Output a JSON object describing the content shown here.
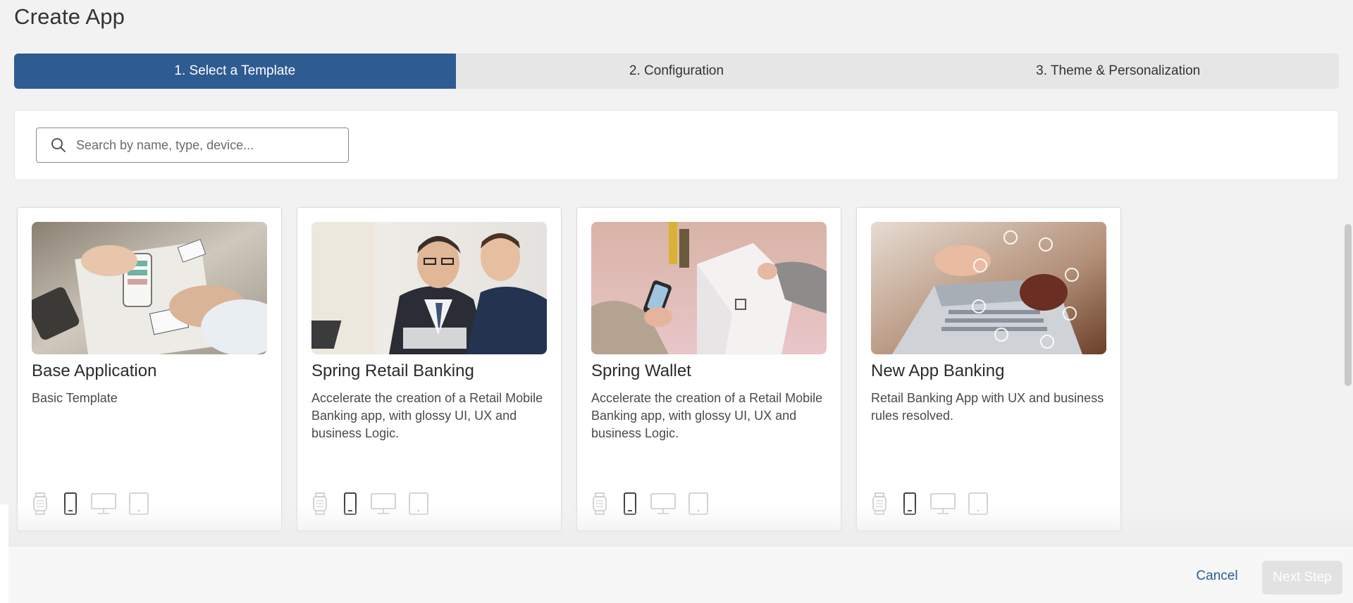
{
  "page": {
    "title": "Create App"
  },
  "stepper": {
    "steps": [
      {
        "label": "1. Select a Template",
        "active": true
      },
      {
        "label": "2. Configuration",
        "active": false
      },
      {
        "label": "3. Theme & Personalization",
        "active": false
      }
    ]
  },
  "search": {
    "placeholder": "Search by name, type, device...",
    "icon": "search-icon"
  },
  "templates": [
    {
      "title": "Base Application",
      "description": "Basic Template",
      "image": "wireframe-sketch-photo",
      "devices": {
        "watch": false,
        "phone": true,
        "desktop": false,
        "tablet": false
      }
    },
    {
      "title": "Spring Retail Banking",
      "description": "Accelerate the creation of a Retail Mobile Banking app, with glossy UI, UX and business Logic.",
      "image": "businessmen-photo",
      "devices": {
        "watch": false,
        "phone": true,
        "desktop": false,
        "tablet": false
      }
    },
    {
      "title": "Spring Wallet",
      "description": "Accelerate the creation of a Retail Mobile Banking app, with glossy UI, UX and business Logic.",
      "image": "mobile-payment-photo",
      "devices": {
        "watch": false,
        "phone": true,
        "desktop": false,
        "tablet": false
      }
    },
    {
      "title": "New App Banking",
      "description": "Retail Banking App with UX and business rules resolved.",
      "image": "laptop-banking-photo",
      "devices": {
        "watch": false,
        "phone": true,
        "desktop": false,
        "tablet": false
      }
    }
  ],
  "footer": {
    "cancel_label": "Cancel",
    "next_label": "Next Step",
    "next_disabled": true
  },
  "colors": {
    "accent": "#2e5b91",
    "background": "#f2f2f2",
    "device_active": "#2b2b2b",
    "device_inactive": "#c8c8c8",
    "disabled_button": "#e2e2e2"
  }
}
